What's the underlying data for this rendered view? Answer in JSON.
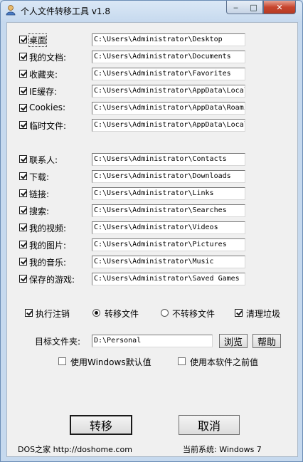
{
  "window": {
    "title": "个人文件转移工具 v1.8",
    "minimize_glyph": "‒",
    "maximize_glyph": "□",
    "close_glyph": "✕"
  },
  "folders_group1": [
    {
      "label": "桌面",
      "checked": true,
      "path": "C:\\Users\\Administrator\\Desktop"
    },
    {
      "label": "我的文档:",
      "checked": true,
      "path": "C:\\Users\\Administrator\\Documents"
    },
    {
      "label": "收藏夹:",
      "checked": true,
      "path": "C:\\Users\\Administrator\\Favorites"
    },
    {
      "label": "IE缓存:",
      "checked": true,
      "path": "C:\\Users\\Administrator\\AppData\\Local"
    },
    {
      "label": "Cookies:",
      "checked": true,
      "path": "C:\\Users\\Administrator\\AppData\\Roami"
    },
    {
      "label": "临时文件:",
      "checked": true,
      "path": "C:\\Users\\Administrator\\AppData\\Local"
    }
  ],
  "folders_group2": [
    {
      "label": "联系人:",
      "checked": true,
      "path": "C:\\Users\\Administrator\\Contacts"
    },
    {
      "label": "下载:",
      "checked": true,
      "path": "C:\\Users\\Administrator\\Downloads"
    },
    {
      "label": "链接:",
      "checked": true,
      "path": "C:\\Users\\Administrator\\Links"
    },
    {
      "label": "搜索:",
      "checked": true,
      "path": "C:\\Users\\Administrator\\Searches"
    },
    {
      "label": "我的视频:",
      "checked": true,
      "path": "C:\\Users\\Administrator\\Videos"
    },
    {
      "label": "我的图片:",
      "checked": true,
      "path": "C:\\Users\\Administrator\\Pictures"
    },
    {
      "label": "我的音乐:",
      "checked": true,
      "path": "C:\\Users\\Administrator\\Music"
    },
    {
      "label": "保存的游戏:",
      "checked": true,
      "path": "C:\\Users\\Administrator\\Saved Games"
    }
  ],
  "options": {
    "logoff": {
      "label": "执行注销",
      "checked": true
    },
    "transfer": {
      "label": "转移文件",
      "selected": true
    },
    "no_transfer": {
      "label": "不转移文件",
      "selected": false
    },
    "cleanup": {
      "label": "清理垃圾",
      "checked": true
    }
  },
  "target": {
    "label": "目标文件夹:",
    "value": "D:\\Personal",
    "browse_label": "浏览",
    "help_label": "帮助"
  },
  "defaults": {
    "use_windows_default": {
      "label": "使用Windows默认值",
      "checked": false
    },
    "use_previous": {
      "label": "使用本软件之前值",
      "checked": false
    }
  },
  "actions": {
    "transfer_label": "转移",
    "cancel_label": "取消"
  },
  "footer": {
    "site": "DOS之家 http://doshome.com",
    "system": "当前系统: Windows 7"
  }
}
